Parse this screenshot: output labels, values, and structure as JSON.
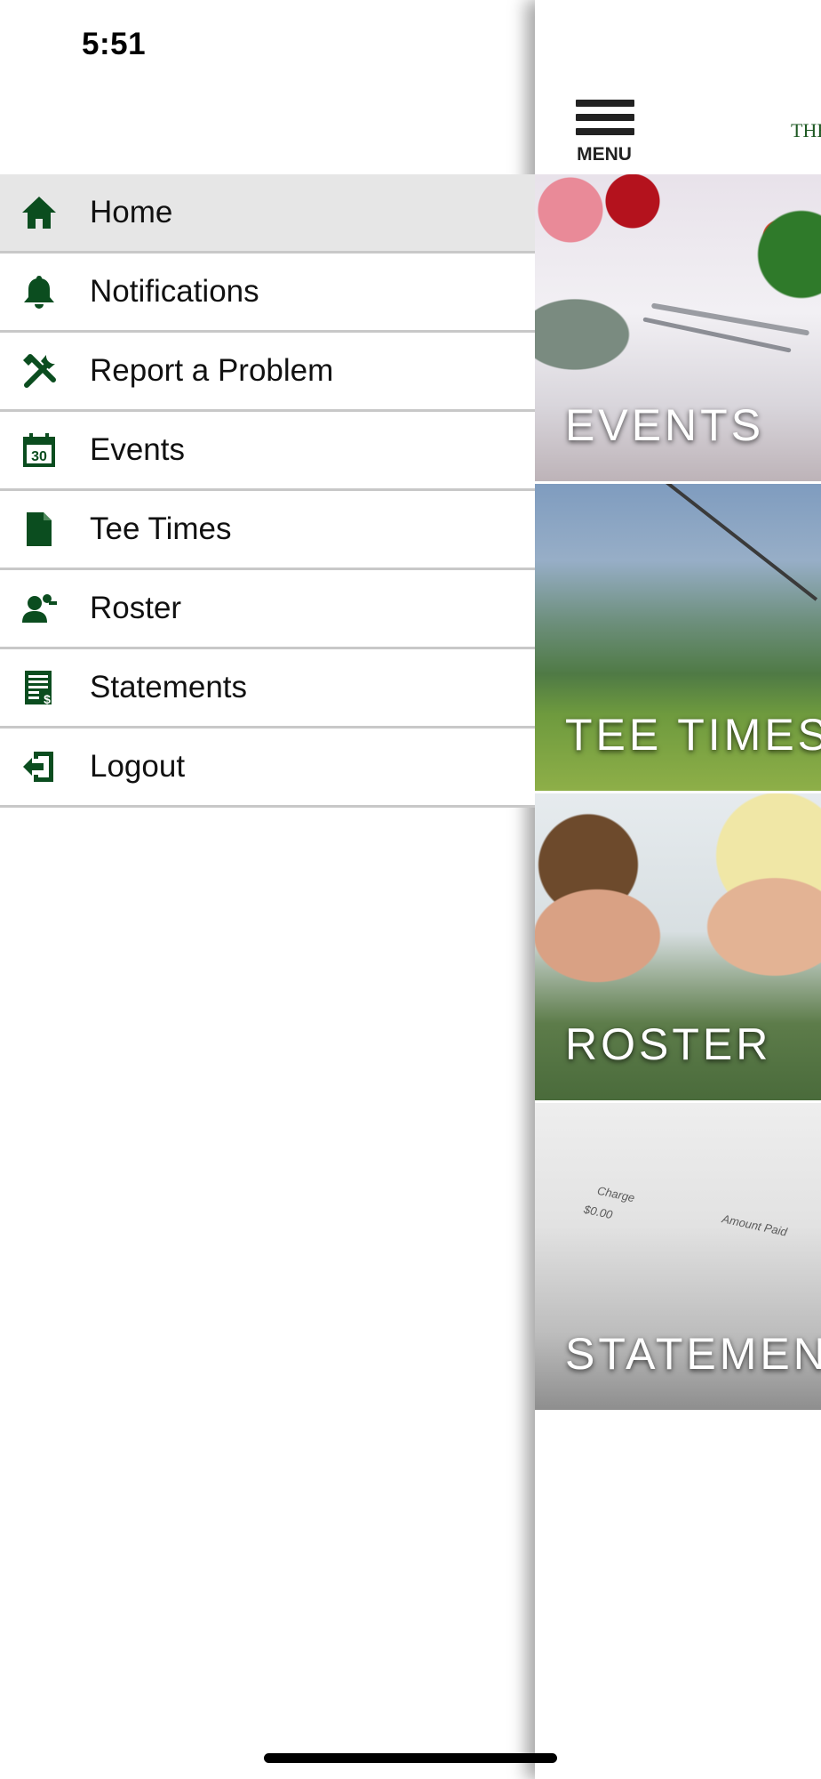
{
  "status_bar": {
    "time": "5:51"
  },
  "header": {
    "menu_label": "MENU",
    "brand_fragment": "THE"
  },
  "drawer": {
    "items": [
      {
        "label": "Home",
        "icon": "home-icon",
        "active": true
      },
      {
        "label": "Notifications",
        "icon": "bell-icon",
        "active": false
      },
      {
        "label": "Report a Problem",
        "icon": "tools-icon",
        "active": false
      },
      {
        "label": "Events",
        "icon": "calendar-icon",
        "active": false
      },
      {
        "label": "Tee Times",
        "icon": "document-icon",
        "active": false
      },
      {
        "label": "Roster",
        "icon": "person-icon",
        "active": false
      },
      {
        "label": "Statements",
        "icon": "statement-icon",
        "active": false
      },
      {
        "label": "Logout",
        "icon": "logout-icon",
        "active": false
      }
    ],
    "calendar_day": "30"
  },
  "tiles": [
    {
      "label": "EVENTS"
    },
    {
      "label": "TEE TIMES"
    },
    {
      "label": "ROSTER"
    },
    {
      "label": "STATEMEN"
    }
  ],
  "statement_image_text": {
    "charge": "Charge",
    "amount_zero": "$0.00",
    "amount_paid": "Amount Paid"
  },
  "colors": {
    "icon_green": "#0b4d1f",
    "active_row": "#e6e6e6",
    "divider": "#c8c8c8",
    "brand_green": "#1f5a24"
  }
}
